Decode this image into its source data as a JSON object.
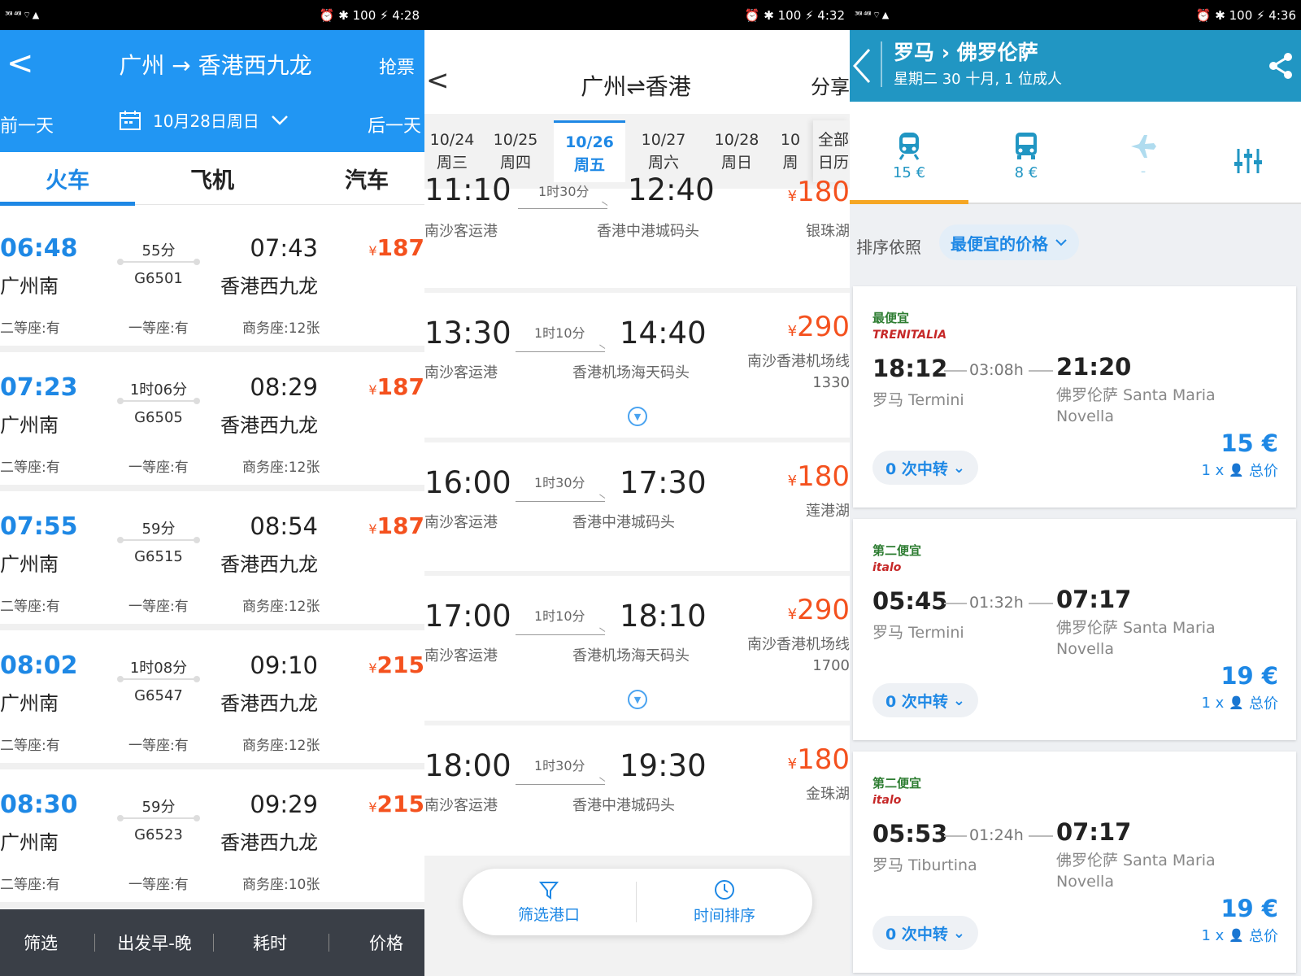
{
  "colors": {
    "blue": "#2196f3",
    "orange": "#f4511e",
    "teal": "#2196c3",
    "green": "#2e7d32"
  },
  "s1": {
    "status": {
      "left": "³⁶ˡˡ ⁴⁶ˡˡ ⌔ ▲",
      "right": "⏰ ✱ 100 ⚡ 4:28"
    },
    "back": "<",
    "title": "广州 → 香港西九龙",
    "grab": "抢票",
    "prev_day": "前一天",
    "date": "10月28日周日",
    "next_day": "后一天",
    "tabs": [
      "火车",
      "飞机",
      "汽车"
    ],
    "rows": [
      {
        "dep": "06:48",
        "from": "广州南",
        "dur": "55分",
        "code": "G6501",
        "arr": "07:43",
        "to": "香港西九龙",
        "price": "187",
        "seat2": "二等座:有",
        "seat1": "一等座:有",
        "seatb": "商务座:12张"
      },
      {
        "dep": "07:23",
        "from": "广州南",
        "dur": "1时06分",
        "code": "G6505",
        "arr": "08:29",
        "to": "香港西九龙",
        "price": "187",
        "seat2": "二等座:有",
        "seat1": "一等座:有",
        "seatb": "商务座:12张"
      },
      {
        "dep": "07:55",
        "from": "广州南",
        "dur": "59分",
        "code": "G6515",
        "arr": "08:54",
        "to": "香港西九龙",
        "price": "187",
        "seat2": "二等座:有",
        "seat1": "一等座:有",
        "seatb": "商务座:12张"
      },
      {
        "dep": "08:02",
        "from": "广州南",
        "dur": "1时08分",
        "code": "G6547",
        "arr": "09:10",
        "to": "香港西九龙",
        "price": "215",
        "seat2": "二等座:有",
        "seat1": "一等座:有",
        "seatb": "商务座:12张"
      },
      {
        "dep": "08:30",
        "from": "广州南",
        "dur": "59分",
        "code": "G6523",
        "arr": "09:29",
        "to": "香港西九龙",
        "price": "215",
        "seat2": "二等座:有",
        "seat1": "一等座:有",
        "seatb": "商务座:10张"
      }
    ],
    "currency": "¥",
    "bottom": [
      "筛选",
      "出发早-晚",
      "耗时",
      "价格"
    ]
  },
  "s2": {
    "status": {
      "right": "⏰ ✱ 100 ⚡ 4:32"
    },
    "back": "<",
    "title": "广州⇌香港",
    "share": "分享",
    "dates": [
      {
        "d": "10/24",
        "w": "周三"
      },
      {
        "d": "10/25",
        "w": "周四"
      },
      {
        "d": "10/26",
        "w": "周五"
      },
      {
        "d": "10/27",
        "w": "周六"
      },
      {
        "d": "10/28",
        "w": "周日"
      },
      {
        "d": "10",
        "w": "周"
      }
    ],
    "all_dates": {
      "a": "全部",
      "b": "日历"
    },
    "partial": {
      "dep": "11:10",
      "dur": "1时30分",
      "arr": "12:40",
      "from": "南沙客运港",
      "to": "香港中港城码头",
      "price": "180",
      "note": "银珠湖"
    },
    "rows": [
      {
        "dep": "13:30",
        "dur": "1时10分",
        "arr": "14:40",
        "from": "南沙客运港",
        "to": "香港机场海天码头",
        "price": "290",
        "note": "南沙香港机场线",
        "num": "1330"
      },
      {
        "dep": "16:00",
        "dur": "1时30分",
        "arr": "17:30",
        "from": "南沙客运港",
        "to": "香港中港城码头",
        "price": "180",
        "note": "莲港湖"
      },
      {
        "dep": "17:00",
        "dur": "1时10分",
        "arr": "18:10",
        "from": "南沙客运港",
        "to": "香港机场海天码头",
        "price": "290",
        "note": "南沙香港机场线",
        "num": "1700"
      },
      {
        "dep": "18:00",
        "dur": "1时30分",
        "arr": "19:30",
        "from": "南沙客运港",
        "to": "香港中港城码头",
        "price": "180",
        "note": "金珠湖"
      }
    ],
    "filter": "筛选港口",
    "sort": "时间排序"
  },
  "s3": {
    "status": {
      "right": "⏰ ✱ 100 ⚡ 4:36"
    },
    "title": "罗马 › 佛罗伦萨",
    "subtitle": "星期二 30 十月, 1 位成人",
    "modes": [
      {
        "price": "15 €"
      },
      {
        "price": "8 €"
      },
      {
        "price": "-"
      }
    ],
    "sort_label": "排序依照",
    "sort_value": "最便宜的价格",
    "cards": [
      {
        "tag": "最便宜",
        "op": "TRENITALIA",
        "dep": "18:12",
        "dur": "03:08h",
        "arr": "21:20",
        "from": "罗马 Termini",
        "to": "佛罗伦萨 Santa Maria Novella",
        "price": "15 €",
        "changes": "0 次中转",
        "per": "1 x",
        "total": "总价"
      },
      {
        "tag": "第二便宜",
        "op": "italo",
        "dep": "05:45",
        "dur": "01:32h",
        "arr": "07:17",
        "from": "罗马 Termini",
        "to": "佛罗伦萨 Santa Maria Novella",
        "price": "19 €",
        "changes": "0 次中转",
        "per": "1 x",
        "total": "总价"
      },
      {
        "tag": "第二便宜",
        "op": "italo",
        "dep": "05:53",
        "dur": "01:24h",
        "arr": "07:17",
        "from": "罗马 Tiburtina",
        "to": "佛罗伦萨 Santa Maria Novella",
        "price": "19 €",
        "changes": "0 次中转",
        "per": "1 x",
        "total": "总价"
      }
    ]
  }
}
